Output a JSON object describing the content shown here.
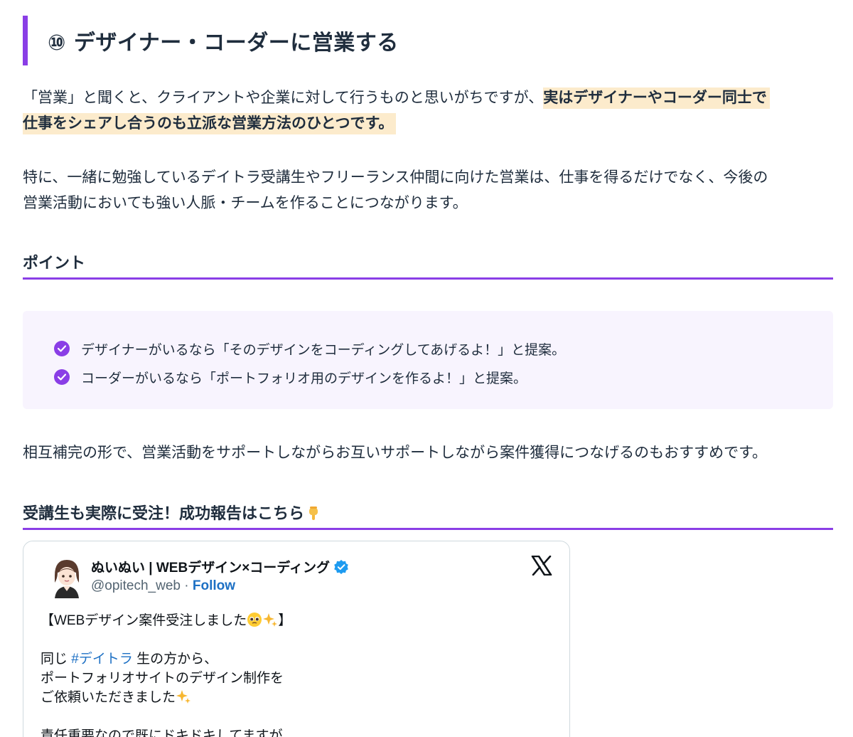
{
  "section": {
    "heading": "⑩ デザイナー・コーダーに営業する",
    "para1_plain": "「営業」と聞くと、クライアントや企業に対して行うものと思いがちですが、",
    "para1_highlight_line1": "実はデザイナーやコーダー同士で",
    "para1_highlight_line2": "仕事をシェアし合うのも立派な営業方法のひとつです。",
    "para2_line1": "特に、一緒に勉強しているデイトラ受講生やフリーランス仲間に向けた営業は、仕事を得るだけでなく、今後の",
    "para2_line2": "営業活動においても強い人脈・チームを作ることにつながります。",
    "point_heading": "ポイント",
    "points": [
      "デザイナーがいるなら「そのデザインをコーディングしてあげるよ！」と提案。",
      "コーダーがいるなら「ポートフォリオ用のデザインを作るよ！」と提案。"
    ],
    "para3": "相互補完の形で、営業活動をサポートしながらお互いサポートしながら案件獲得につなげるのもおすすめです。",
    "report_heading": "受講生も実際に受注！成功報告はこちら"
  },
  "tweet": {
    "name": "ぬいぬい | WEBデザイン×コーディング",
    "handle": "@opitech_web",
    "separator": "·",
    "follow": "Follow",
    "line1_text": "【WEBデザイン案件受注しました",
    "line1_close": "】",
    "line2_pre": "同じ ",
    "line2_tag": "#デイトラ",
    "line2_post": " 生の方から、",
    "line3": "ポートフォリオサイトのデザイン制作を",
    "line4_text": "ご依頼いただきました",
    "line5": "責任重要なので既にドキドキしてますが"
  },
  "colors": {
    "accent_purple": "#8a3ee6",
    "highlight": "#fcebcc",
    "box_bg": "#f8f4fe",
    "link_blue": "#1d70c4"
  }
}
